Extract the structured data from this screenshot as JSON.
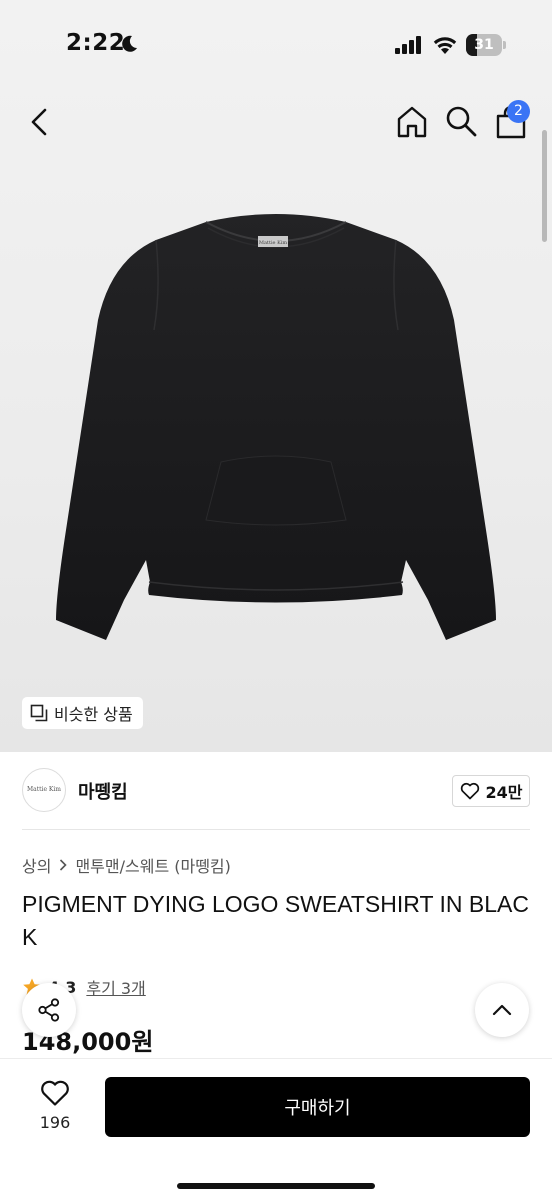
{
  "status_bar": {
    "time": "2:22",
    "battery": "31",
    "battery_level": 0.31
  },
  "header": {
    "cart_count": "2"
  },
  "product_image": {
    "logo_text": "Mattie Kim",
    "color": "#1c1c1e"
  },
  "similar_products": {
    "label": "비슷한 상품"
  },
  "brand": {
    "logo_text": "Mattie Kim",
    "name": "마뗑킴",
    "likes": "24만"
  },
  "breadcrumb": {
    "category": "상의",
    "subcategory": "맨투맨/스웨트 (마뗑킴)"
  },
  "product": {
    "title": "PIGMENT DYING LOGO SWEATSHIRT IN BLACK",
    "rating": "4.3",
    "review_link": "후기 3개",
    "price": "148,000원"
  },
  "bottom_bar": {
    "wish_count": "196",
    "buy_label": "구매하기"
  },
  "colors": {
    "accent": "#3a74f5",
    "star": "#f5a524",
    "buy_button": "#000000"
  }
}
